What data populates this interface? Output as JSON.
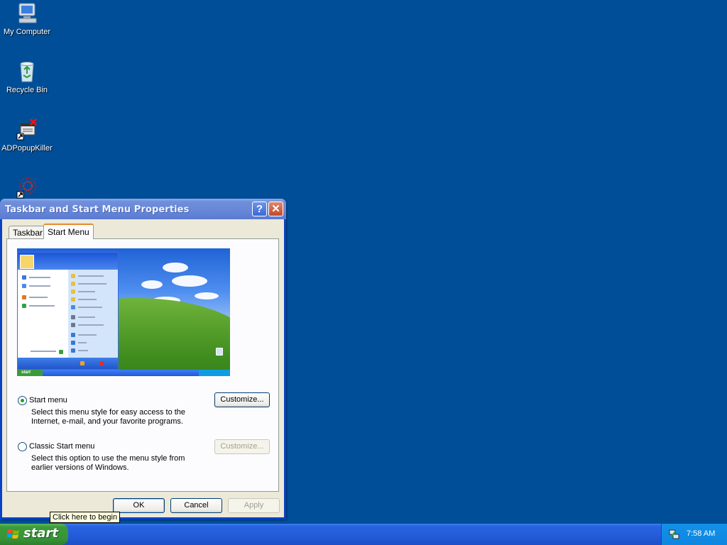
{
  "desktop": {
    "icons": [
      {
        "label": "My Computer",
        "icon": "my-computer-icon"
      },
      {
        "label": "Recycle Bin",
        "icon": "recycle-bin-icon"
      },
      {
        "label": "ADPopupKiller",
        "icon": "adpopupkiller-icon"
      },
      {
        "label": "",
        "icon": "shortcut-icon"
      }
    ]
  },
  "dialog": {
    "title": "Taskbar and Start Menu Properties",
    "help_glyph": "?",
    "close_glyph": "✕",
    "tabs": [
      {
        "label": "Taskbar",
        "active": false
      },
      {
        "label": "Start Menu",
        "active": true
      }
    ],
    "options": [
      {
        "label": "Start menu",
        "selected": true,
        "description_line1": "Select this menu style for easy access to the",
        "description_line2": "Internet, e-mail, and your favorite programs.",
        "button": "Customize...",
        "button_enabled": true
      },
      {
        "label": "Classic Start menu",
        "selected": false,
        "description_line1": "Select this option to use the menu style from",
        "description_line2": "earlier versions of Windows.",
        "button": "Customize...",
        "button_enabled": false
      }
    ],
    "buttons": {
      "ok": "OK",
      "cancel": "Cancel",
      "apply": "Apply"
    }
  },
  "tooltip": "Click here to begin",
  "taskbar": {
    "start_label": "start",
    "clock": "7:58 AM"
  },
  "colors": {
    "desktop": "#004e98",
    "taskbar": "#245edb",
    "start_button": "#3c9a3c",
    "dialog_face": "#ece9d8"
  }
}
